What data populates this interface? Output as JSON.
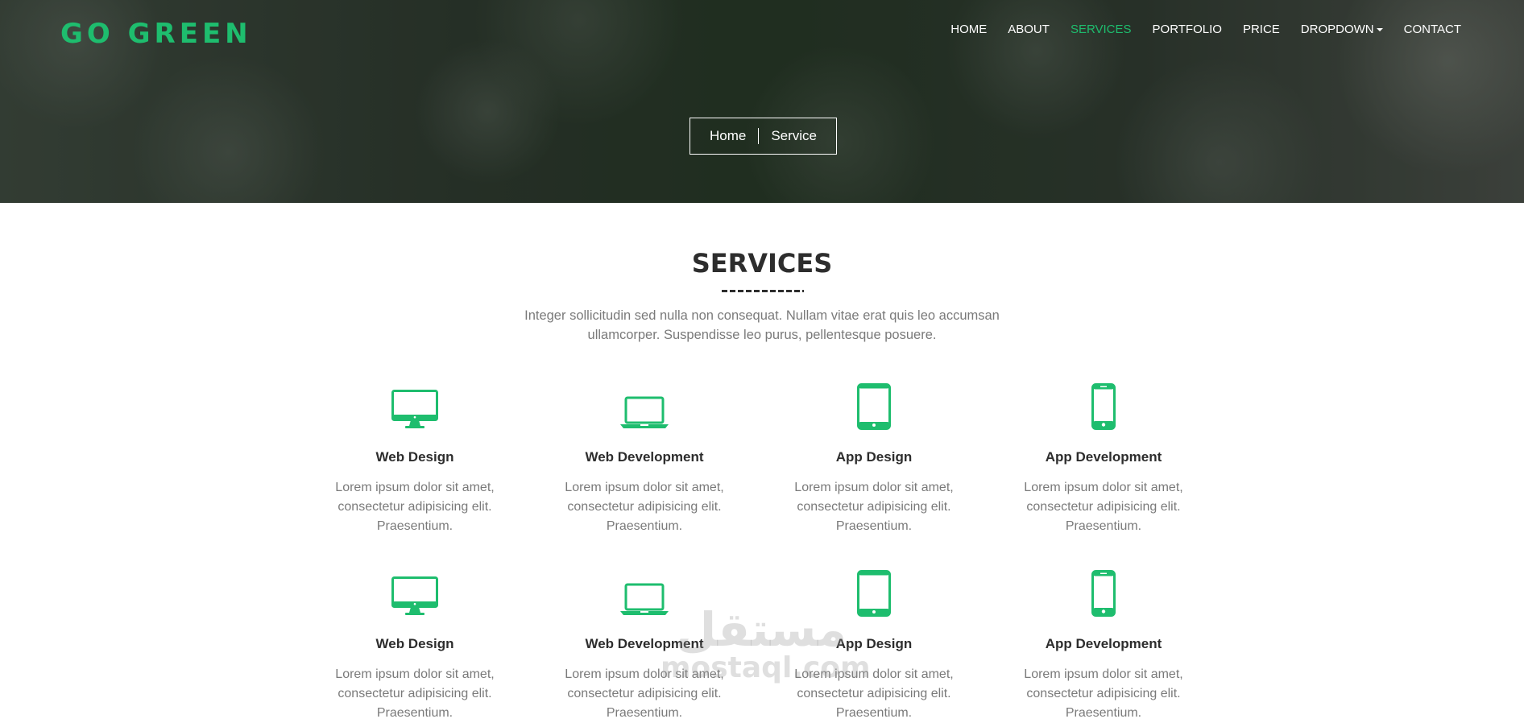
{
  "brand": {
    "logo": "GO GREEN",
    "accent_color": "#1ebd6e"
  },
  "nav": {
    "items": [
      {
        "label": "HOME",
        "active": false
      },
      {
        "label": "ABOUT",
        "active": false
      },
      {
        "label": "SERVICES",
        "active": true
      },
      {
        "label": "PORTFOLIO",
        "active": false
      },
      {
        "label": "PRICE",
        "active": false
      },
      {
        "label": "DROPDOWN",
        "active": false,
        "has_caret": true
      },
      {
        "label": "CONTACT",
        "active": false
      }
    ]
  },
  "breadcrumb": {
    "home": "Home",
    "current": "Service"
  },
  "services": {
    "title": "SERVICES",
    "intro": "Integer sollicitudin sed nulla non consequat. Nullam vitae erat quis leo accumsan ullamcorper. Suspendisse leo purus, pellentesque posuere.",
    "cards": [
      {
        "icon": "desktop-icon",
        "title": "Web Design",
        "text": "Lorem ipsum dolor sit amet, consectetur adipisicing elit. Praesentium."
      },
      {
        "icon": "laptop-icon",
        "title": "Web Development",
        "text": "Lorem ipsum dolor sit amet, consectetur adipisicing elit. Praesentium."
      },
      {
        "icon": "tablet-icon",
        "title": "App Design",
        "text": "Lorem ipsum dolor sit amet, consectetur adipisicing elit. Praesentium."
      },
      {
        "icon": "mobile-icon",
        "title": "App Development",
        "text": "Lorem ipsum dolor sit amet, consectetur adipisicing elit. Praesentium."
      },
      {
        "icon": "desktop-icon",
        "title": "Web Design",
        "text": "Lorem ipsum dolor sit amet, consectetur adipisicing elit. Praesentium."
      },
      {
        "icon": "laptop-icon",
        "title": "Web Development",
        "text": "Lorem ipsum dolor sit amet, consectetur adipisicing elit. Praesentium."
      },
      {
        "icon": "tablet-icon",
        "title": "App Design",
        "text": "Lorem ipsum dolor sit amet, consectetur adipisicing elit. Praesentium."
      },
      {
        "icon": "mobile-icon",
        "title": "App Development",
        "text": "Lorem ipsum dolor sit amet, consectetur adipisicing elit. Praesentium."
      }
    ]
  },
  "watermark": {
    "arabic": "مستقل",
    "latin": "mostaql.com"
  }
}
